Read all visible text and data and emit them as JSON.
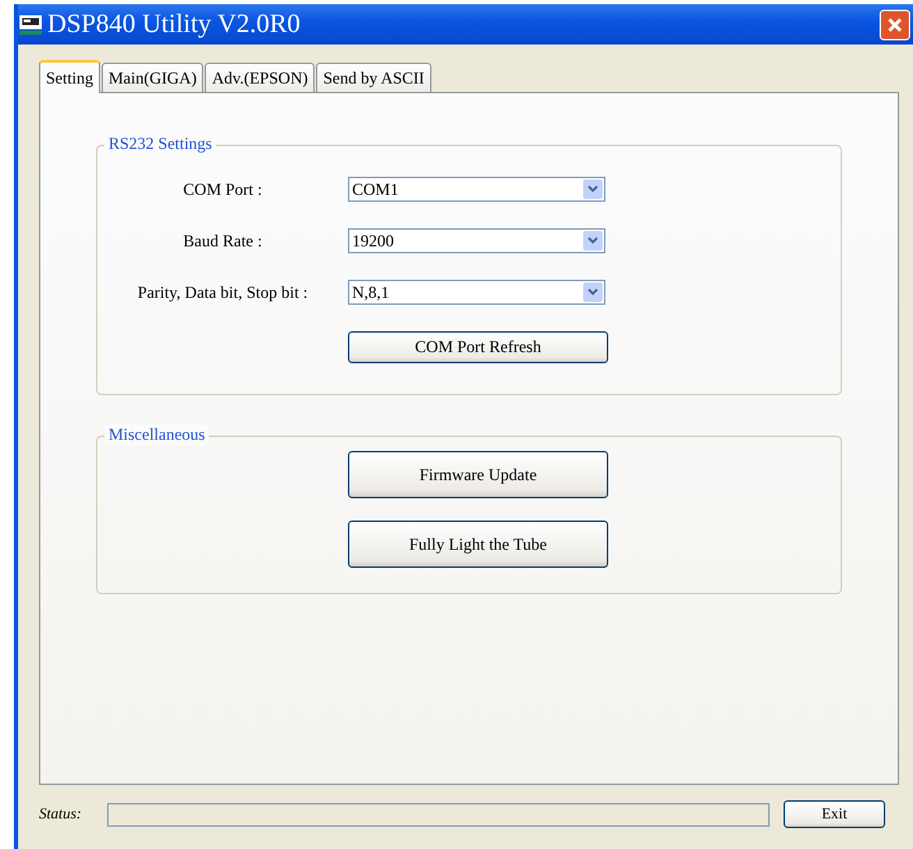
{
  "window": {
    "title": "DSP840 Utility V2.0R0"
  },
  "tabs": [
    {
      "label": "Setting",
      "selected": true
    },
    {
      "label": "Main(GIGA)",
      "selected": false
    },
    {
      "label": "Adv.(EPSON)",
      "selected": false
    },
    {
      "label": "Send by ASCII",
      "selected": false
    }
  ],
  "rs232": {
    "title": "RS232 Settings",
    "fields": [
      {
        "label": "COM Port :",
        "value": "COM1"
      },
      {
        "label": "Baud Rate :",
        "value": "19200"
      },
      {
        "label": "Parity, Data bit, Stop bit :",
        "value": "N,8,1"
      }
    ],
    "button": "COM Port Refresh"
  },
  "misc": {
    "title": "Miscellaneous",
    "buttons": [
      "Firmware Update",
      "Fully Light the Tube"
    ]
  },
  "status_bar": {
    "label": "Status:",
    "button": "Exit"
  }
}
